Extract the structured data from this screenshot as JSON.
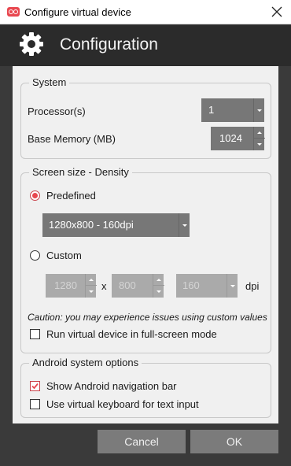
{
  "window": {
    "title": "Configure virtual device",
    "icon": "app-logo-icon",
    "close_icon": "close-icon"
  },
  "header": {
    "title": "Configuration",
    "icon": "gear-icon"
  },
  "system": {
    "legend": "System",
    "processors_label": "Processor(s)",
    "processors_value": "1",
    "memory_label": "Base Memory (MB)",
    "memory_value": "1024"
  },
  "screen": {
    "legend": "Screen size - Density",
    "predefined_label": "Predefined",
    "predefined_selected": true,
    "predefined_value": "1280x800 - 160dpi",
    "custom_label": "Custom",
    "custom_selected": false,
    "width_value": "1280",
    "x_label": "x",
    "height_value": "800",
    "dpi_value": "160",
    "dpi_label": "dpi",
    "caution": "Caution: you may experience issues using custom values",
    "fullscreen_label": "Run virtual device in full-screen mode",
    "fullscreen_checked": false
  },
  "android": {
    "legend": "Android system options",
    "navbar_label": "Show Android navigation bar",
    "navbar_checked": true,
    "keyboard_label": "Use virtual keyboard for text input",
    "keyboard_checked": false
  },
  "buttons": {
    "cancel": "Cancel",
    "ok": "OK"
  },
  "colors": {
    "accent": "#e8474f",
    "header_bg": "#2b2b2b",
    "frame_bg": "#3a3a3a",
    "panel_bg": "#f0f0f0",
    "control_bg": "#777777",
    "control_disabled_bg": "#aaaaaa"
  }
}
